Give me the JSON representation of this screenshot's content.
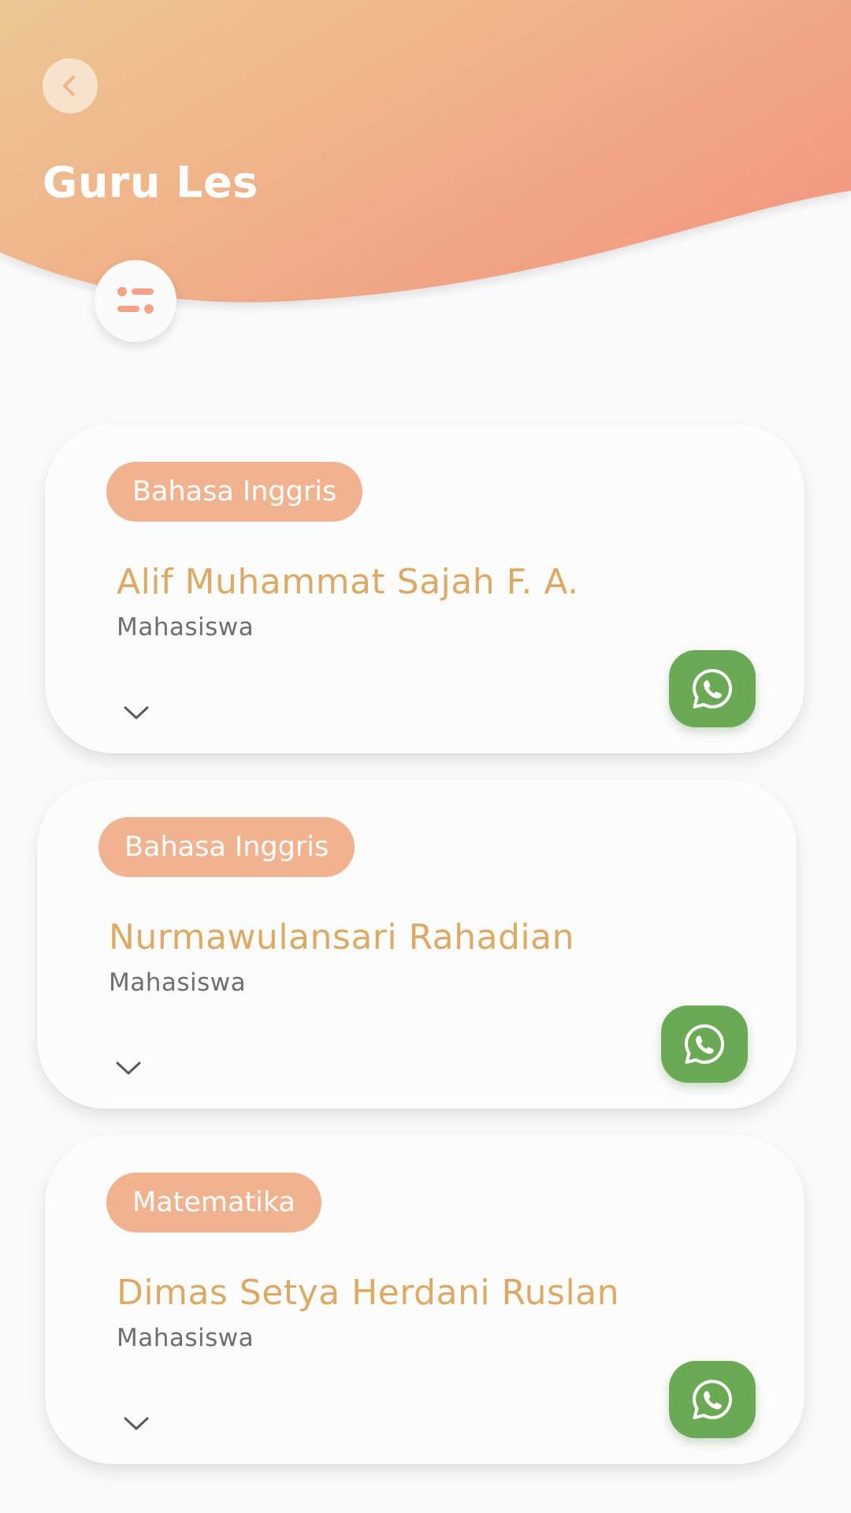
{
  "header": {
    "title": "Guru Les",
    "back_icon": "chevron-left-icon",
    "filter_icon": "filter-toggle-icon",
    "gradient_start": "#ecc792",
    "gradient_end": "#f19b82"
  },
  "colors": {
    "badge": "#f1b38f",
    "name": "#dcaa64",
    "role": "#6e6e6e",
    "whatsapp": "#6aaa54"
  },
  "teachers": [
    {
      "subject": "Bahasa Inggris",
      "name": "Alif Muhammat Sajah F. A.",
      "role": "Mahasiswa",
      "contact_icon": "whatsapp-icon",
      "expand_icon": "chevron-down-icon"
    },
    {
      "subject": "Bahasa Inggris",
      "name": "Nurmawulansari Rahadian",
      "role": "Mahasiswa",
      "contact_icon": "whatsapp-icon",
      "expand_icon": "chevron-down-icon"
    },
    {
      "subject": "Matematika",
      "name": "Dimas Setya Herdani Ruslan",
      "role": "Mahasiswa",
      "contact_icon": "whatsapp-icon",
      "expand_icon": "chevron-down-icon"
    }
  ]
}
